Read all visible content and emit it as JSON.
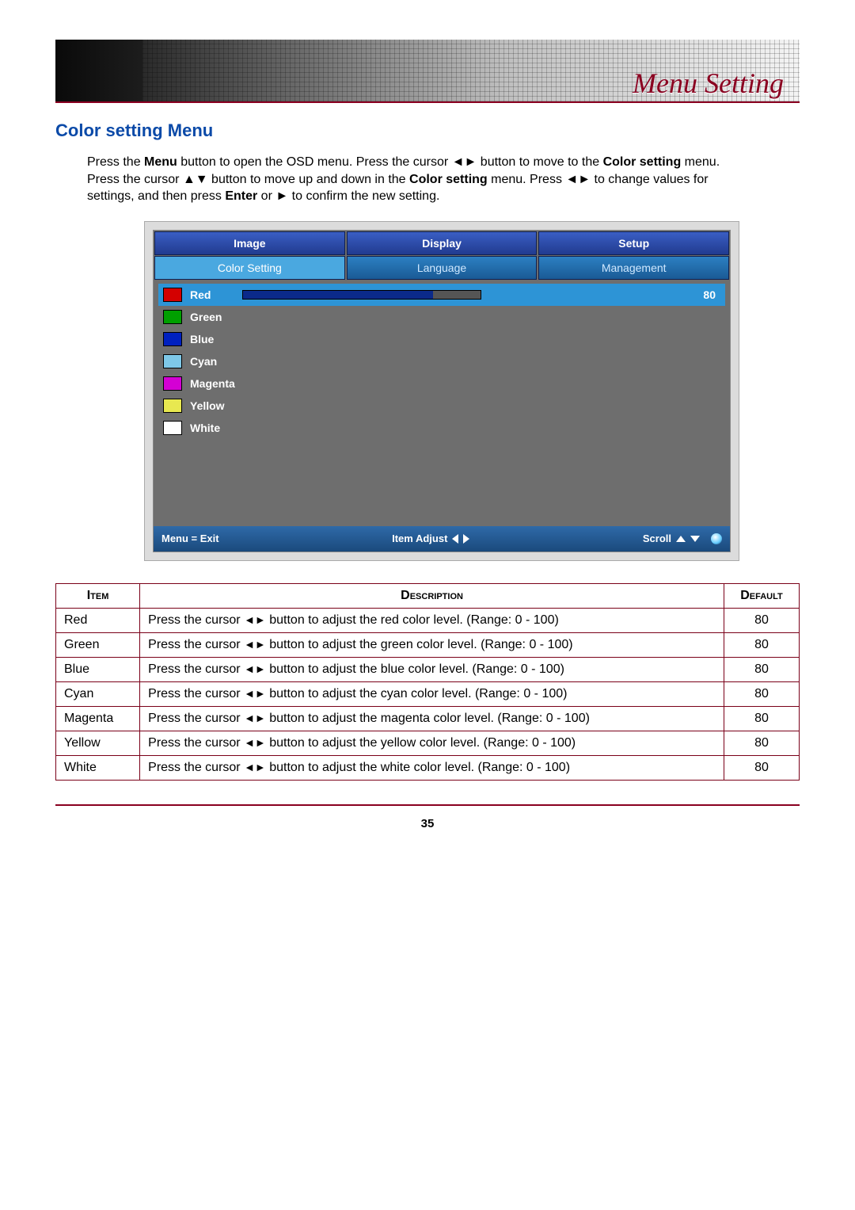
{
  "banner_title": "Menu Setting",
  "section_title": "Color setting Menu",
  "intro": {
    "p1a": "Press the ",
    "menu_b": "Menu",
    "p1b": " button to open the OSD menu. Press the cursor ",
    "lr1": "◄►",
    "p1c": " button to move to the ",
    "cs_b1": "Color setting",
    "p1d": " menu. Press the cursor ",
    "ud": "▲▼",
    "p1e": " button to move up and down in the ",
    "cs_b2": "Color setting",
    "p1f": " menu. Press ",
    "lr2": "◄►",
    "p1g": " to change values for settings, and then press ",
    "enter_b": "Enter",
    "p1h": " or ",
    "r_arrow": "►",
    "p1i": " to confirm the new setting."
  },
  "osd": {
    "tabs_top": [
      "Image",
      "Display",
      "Setup"
    ],
    "tabs_bottom": [
      "Color Setting",
      "Language",
      "Management"
    ],
    "active_top": 0,
    "active_bottom": 0,
    "items": [
      {
        "label": "Red",
        "swatch": "#d40000",
        "selected": true,
        "value": 80,
        "pct": 80
      },
      {
        "label": "Green",
        "swatch": "#00a000"
      },
      {
        "label": "Blue",
        "swatch": "#0020c0"
      },
      {
        "label": "Cyan",
        "swatch": "#7ec8e8"
      },
      {
        "label": "Magenta",
        "swatch": "#d400d4"
      },
      {
        "label": "Yellow",
        "swatch": "#e8e850"
      },
      {
        "label": "White",
        "swatch": "#ffffff"
      }
    ],
    "foot": {
      "exit": "Menu = Exit",
      "adjust": "Item Adjust",
      "scroll": "Scroll"
    }
  },
  "table": {
    "headers": {
      "item": "Item",
      "desc": "Description",
      "def": "Default"
    },
    "lr": "◄►",
    "rows": [
      {
        "item": "Red",
        "pre": "Press the cursor ",
        "post": " button to adjust the red color level. (Range: 0 - 100)",
        "def": "80"
      },
      {
        "item": "Green",
        "pre": "Press the cursor ",
        "post": " button to adjust the green color level. (Range: 0 - 100)",
        "def": "80"
      },
      {
        "item": "Blue",
        "pre": "Press the cursor ",
        "post": " button to adjust the blue color level. (Range: 0 - 100)",
        "def": "80"
      },
      {
        "item": "Cyan",
        "pre": "Press the cursor ",
        "post": " button to adjust the cyan color level. (Range: 0 - 100)",
        "def": "80"
      },
      {
        "item": "Magenta",
        "pre": "Press the cursor ",
        "post": " button to adjust the magenta color level. (Range: 0 - 100)",
        "def": "80"
      },
      {
        "item": "Yellow",
        "pre": "Press the cursor ",
        "post": " button to adjust the yellow color level. (Range: 0 - 100)",
        "def": "80"
      },
      {
        "item": "White",
        "pre": "Press the cursor ",
        "post": " button to adjust the white color level. (Range: 0 - 100)",
        "def": "80"
      }
    ]
  },
  "page_number": "35"
}
